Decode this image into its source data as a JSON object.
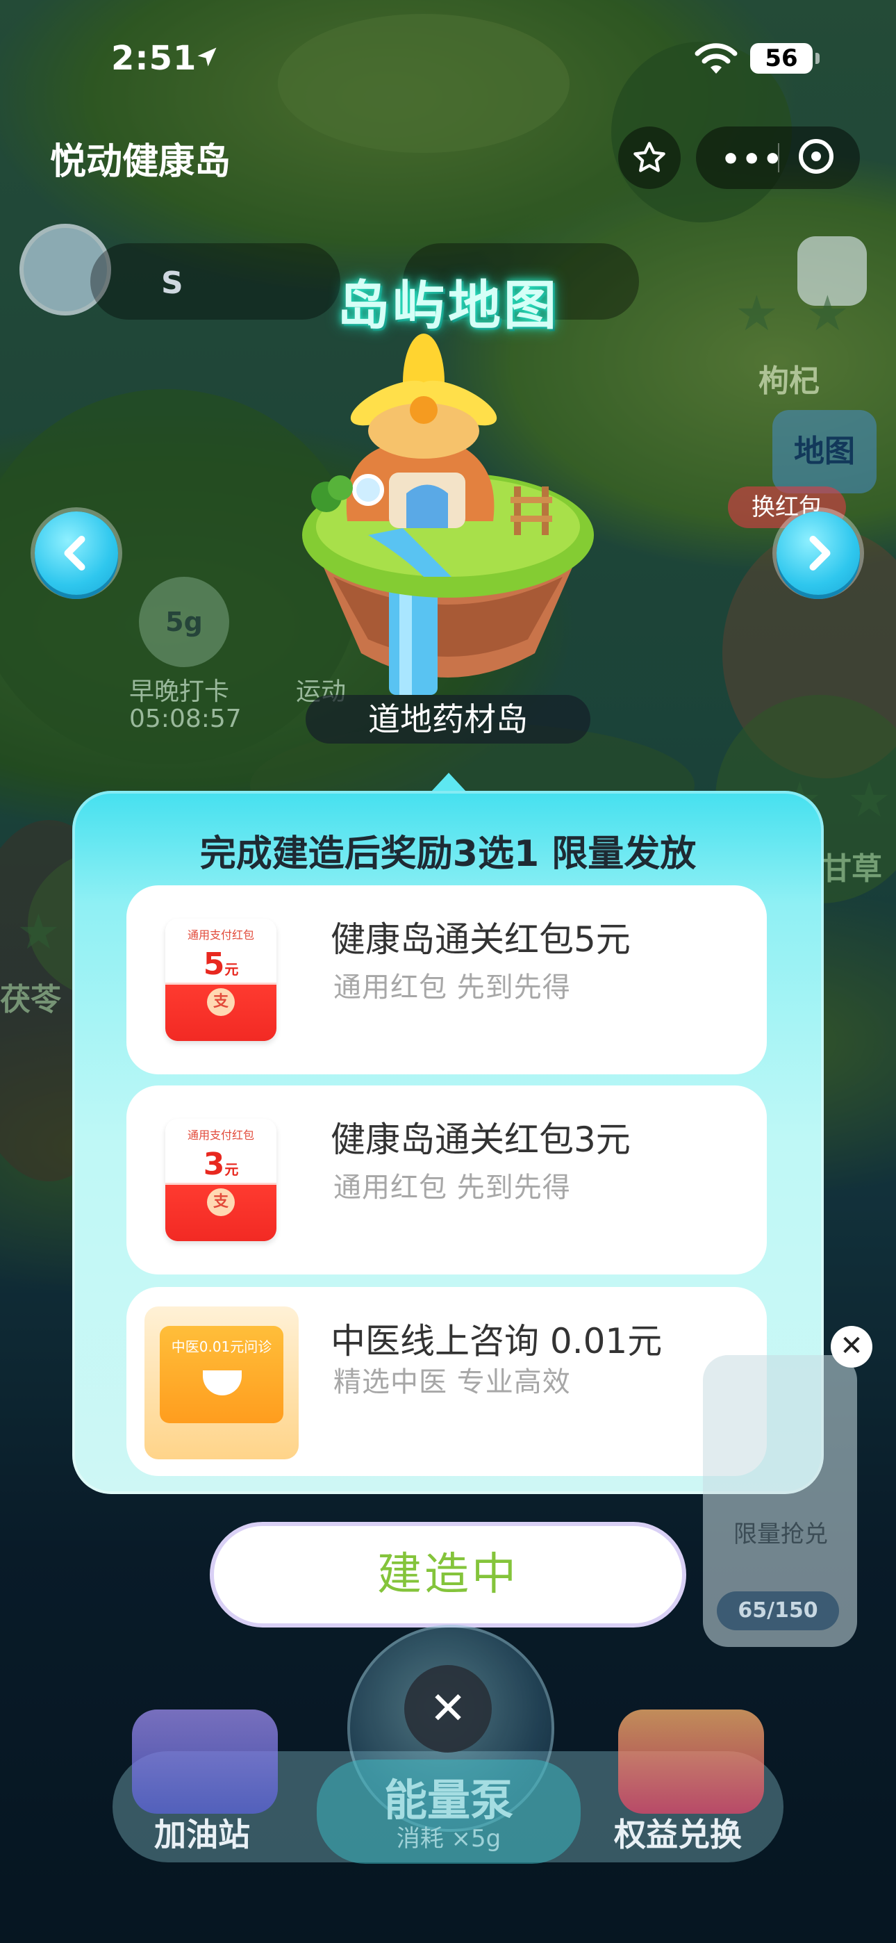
{
  "status_bar": {
    "time": "2:51",
    "battery": "56"
  },
  "nav": {
    "title": "悦动健康岛"
  },
  "hud": {
    "score_letter": "S",
    "energy_5g": "5g",
    "checkin_label": "早晚打卡",
    "checkin_timer": "05:08:57",
    "sport_label": "运动",
    "gouqi_label": "枸杞",
    "map_button": "地图",
    "exchange_button": "换红包",
    "fuling_label": "茯苓",
    "gancao_label": "甘草"
  },
  "map": {
    "title": "岛屿地图",
    "island_name": "道地药材岛"
  },
  "reward_panel": {
    "heading": "完成建造后奖励3选1 限量发放",
    "rewards": [
      {
        "title": "健康岛通关红包5元",
        "subtitle": "通用红包 先到先得",
        "envelope_caption": "通用支付红包",
        "amount": "5",
        "unit": "元"
      },
      {
        "title": "健康岛通关红包3元",
        "subtitle": "通用红包 先到先得",
        "envelope_caption": "通用支付红包",
        "amount": "3",
        "unit": "元"
      },
      {
        "title": "中医线上咨询  0.01元",
        "subtitle": "精选中医  专业高效",
        "ticket_caption": "中医0.01元问诊"
      }
    ]
  },
  "build_button": {
    "label": "建造中"
  },
  "limited": {
    "label": "限量抢兑",
    "progress": "65/150"
  },
  "bottom": {
    "gas_station": "加油站",
    "pump_title": "能量泵",
    "pump_cost": "消耗 ×5g",
    "exchange": "权益兑换"
  },
  "colors": {
    "accent_cyan": "#2fc7ee",
    "build_text": "#84c43b",
    "envelope_red": "#ff3b30"
  }
}
